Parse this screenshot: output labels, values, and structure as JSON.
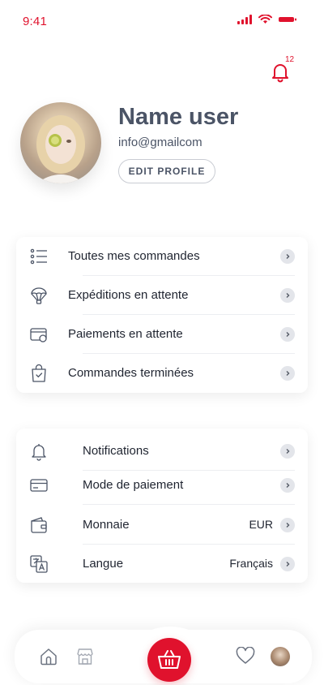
{
  "status_bar": {
    "time": "9:41"
  },
  "notifications_badge": {
    "count": "12"
  },
  "profile": {
    "name": "Name user",
    "email": "info@gmailcom",
    "edit_button": "EDIT PROFILE"
  },
  "orders_menu": {
    "items": [
      {
        "label": "Toutes mes commandes",
        "icon": "list-icon"
      },
      {
        "label": "Expéditions en attente",
        "icon": "parachute-icon"
      },
      {
        "label": "Paiements en attente",
        "icon": "wallet-icon"
      },
      {
        "label": "Commandes terminées",
        "icon": "bag-check-icon"
      }
    ]
  },
  "settings_menu": {
    "items": [
      {
        "label": "Notifications",
        "value": "",
        "icon": "bell-icon"
      },
      {
        "label": "Mode de paiement",
        "value": "",
        "icon": "credit-card-icon"
      },
      {
        "label": "Monnaie",
        "value": "EUR",
        "icon": "wallet-icon"
      },
      {
        "label": "Langue",
        "value": "Français",
        "icon": "translate-icon"
      }
    ]
  },
  "bottom_nav": {
    "items": [
      "home-icon",
      "store-icon",
      "basket-icon",
      "heart-icon",
      "profile-avatar"
    ]
  },
  "colors": {
    "accent": "#e0122d",
    "text": "#1f2430",
    "muted": "#4b5466"
  }
}
